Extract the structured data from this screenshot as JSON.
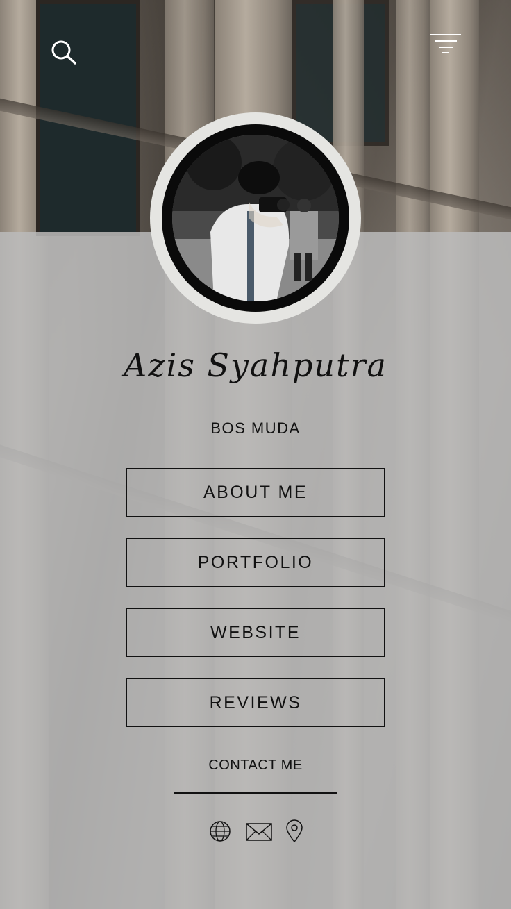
{
  "profile": {
    "name": "Azis Syahputra",
    "tagline": "BOS MUDA"
  },
  "header": {
    "search_icon": "search-icon",
    "menu_icon": "menu-icon"
  },
  "buttons": [
    {
      "label": "ABOUT ME"
    },
    {
      "label": "PORTFOLIO"
    },
    {
      "label": "WEBSITE"
    },
    {
      "label": "REVIEWS"
    }
  ],
  "contact": {
    "label": "CONTACT ME",
    "icons": [
      "globe-icon",
      "mail-icon",
      "location-pin-icon"
    ]
  }
}
